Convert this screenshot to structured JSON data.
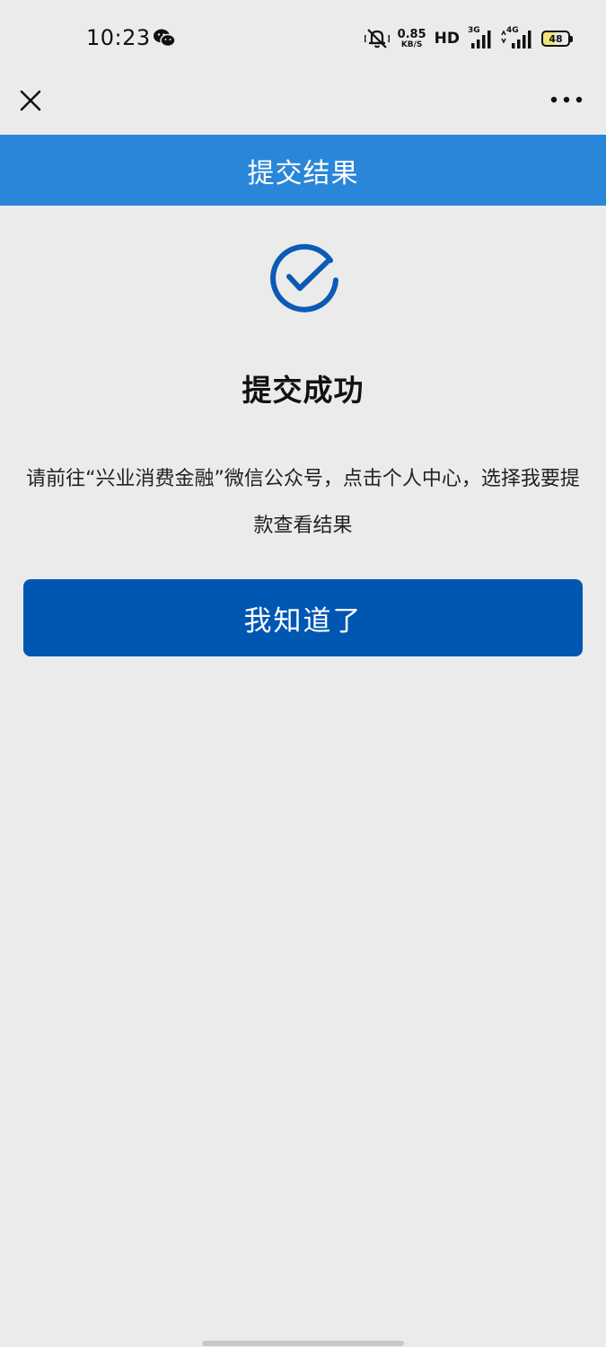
{
  "status_bar": {
    "time": "10:23",
    "net_speed_value": "0.85",
    "net_speed_unit": "KB/S",
    "hd_label": "HD",
    "signal1_label": "3G",
    "signal2_label": "4G",
    "battery_level": "48",
    "icons": [
      "wechat-icon",
      "mute-icon",
      "signal-icon",
      "battery-icon"
    ]
  },
  "nav": {
    "icons": [
      "close-icon",
      "more-icon"
    ]
  },
  "header": {
    "title": "提交结果",
    "background_color": "#2a86d8"
  },
  "result": {
    "icon": "check-circle-icon",
    "icon_color": "#0a5bb5",
    "heading": "提交成功",
    "message": "请前往“兴业消费金融”微信公众号，点击个人中心，选择我要提款查看结果"
  },
  "actions": {
    "confirm_label": "我知道了",
    "confirm_color": "#0057b2"
  }
}
